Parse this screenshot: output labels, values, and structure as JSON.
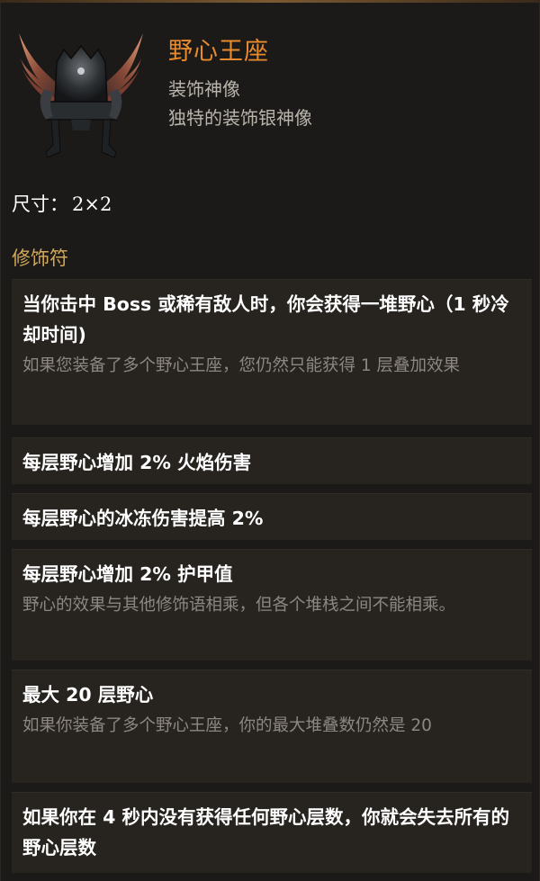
{
  "item": {
    "name": "野心王座",
    "type": "装饰神像",
    "description": "独特的装饰银神像",
    "size_label": "尺寸：",
    "size_value": "2×2"
  },
  "affixes": {
    "heading": "修饰符",
    "list": [
      {
        "main": "当你击中 Boss 或稀有敌人时，你会获得一堆野心（1 秒冷却时间)",
        "sub": "如果您装备了多个野心王座，您仍然只能获得 1 层叠加效果"
      },
      {
        "main": "每层野心增加 2% 火焰伤害",
        "sub": ""
      },
      {
        "main": "每层野心的冰冻伤害提高 2%",
        "sub": ""
      },
      {
        "main": "每层野心增加 2% 护甲值",
        "sub": "野心的效果与其他修饰语相乘，但各个堆栈之间不能相乘。"
      },
      {
        "main": "最大 20 层野心",
        "sub": "如果你装备了多个野心王座，你的最大堆叠数仍然是 20"
      },
      {
        "main": "如果你在 4 秒内没有获得任何野心层数，你就会失去所有的野心层数",
        "sub": ""
      }
    ]
  },
  "colors": {
    "title": "#e88a2e",
    "heading": "#d2a85a",
    "secondary": "#b9b4ac",
    "note": "#8c8781",
    "box": "#27231f",
    "background": "#1c1a18"
  },
  "icons": {
    "item_icon": "winged-throne-statue-icon"
  }
}
